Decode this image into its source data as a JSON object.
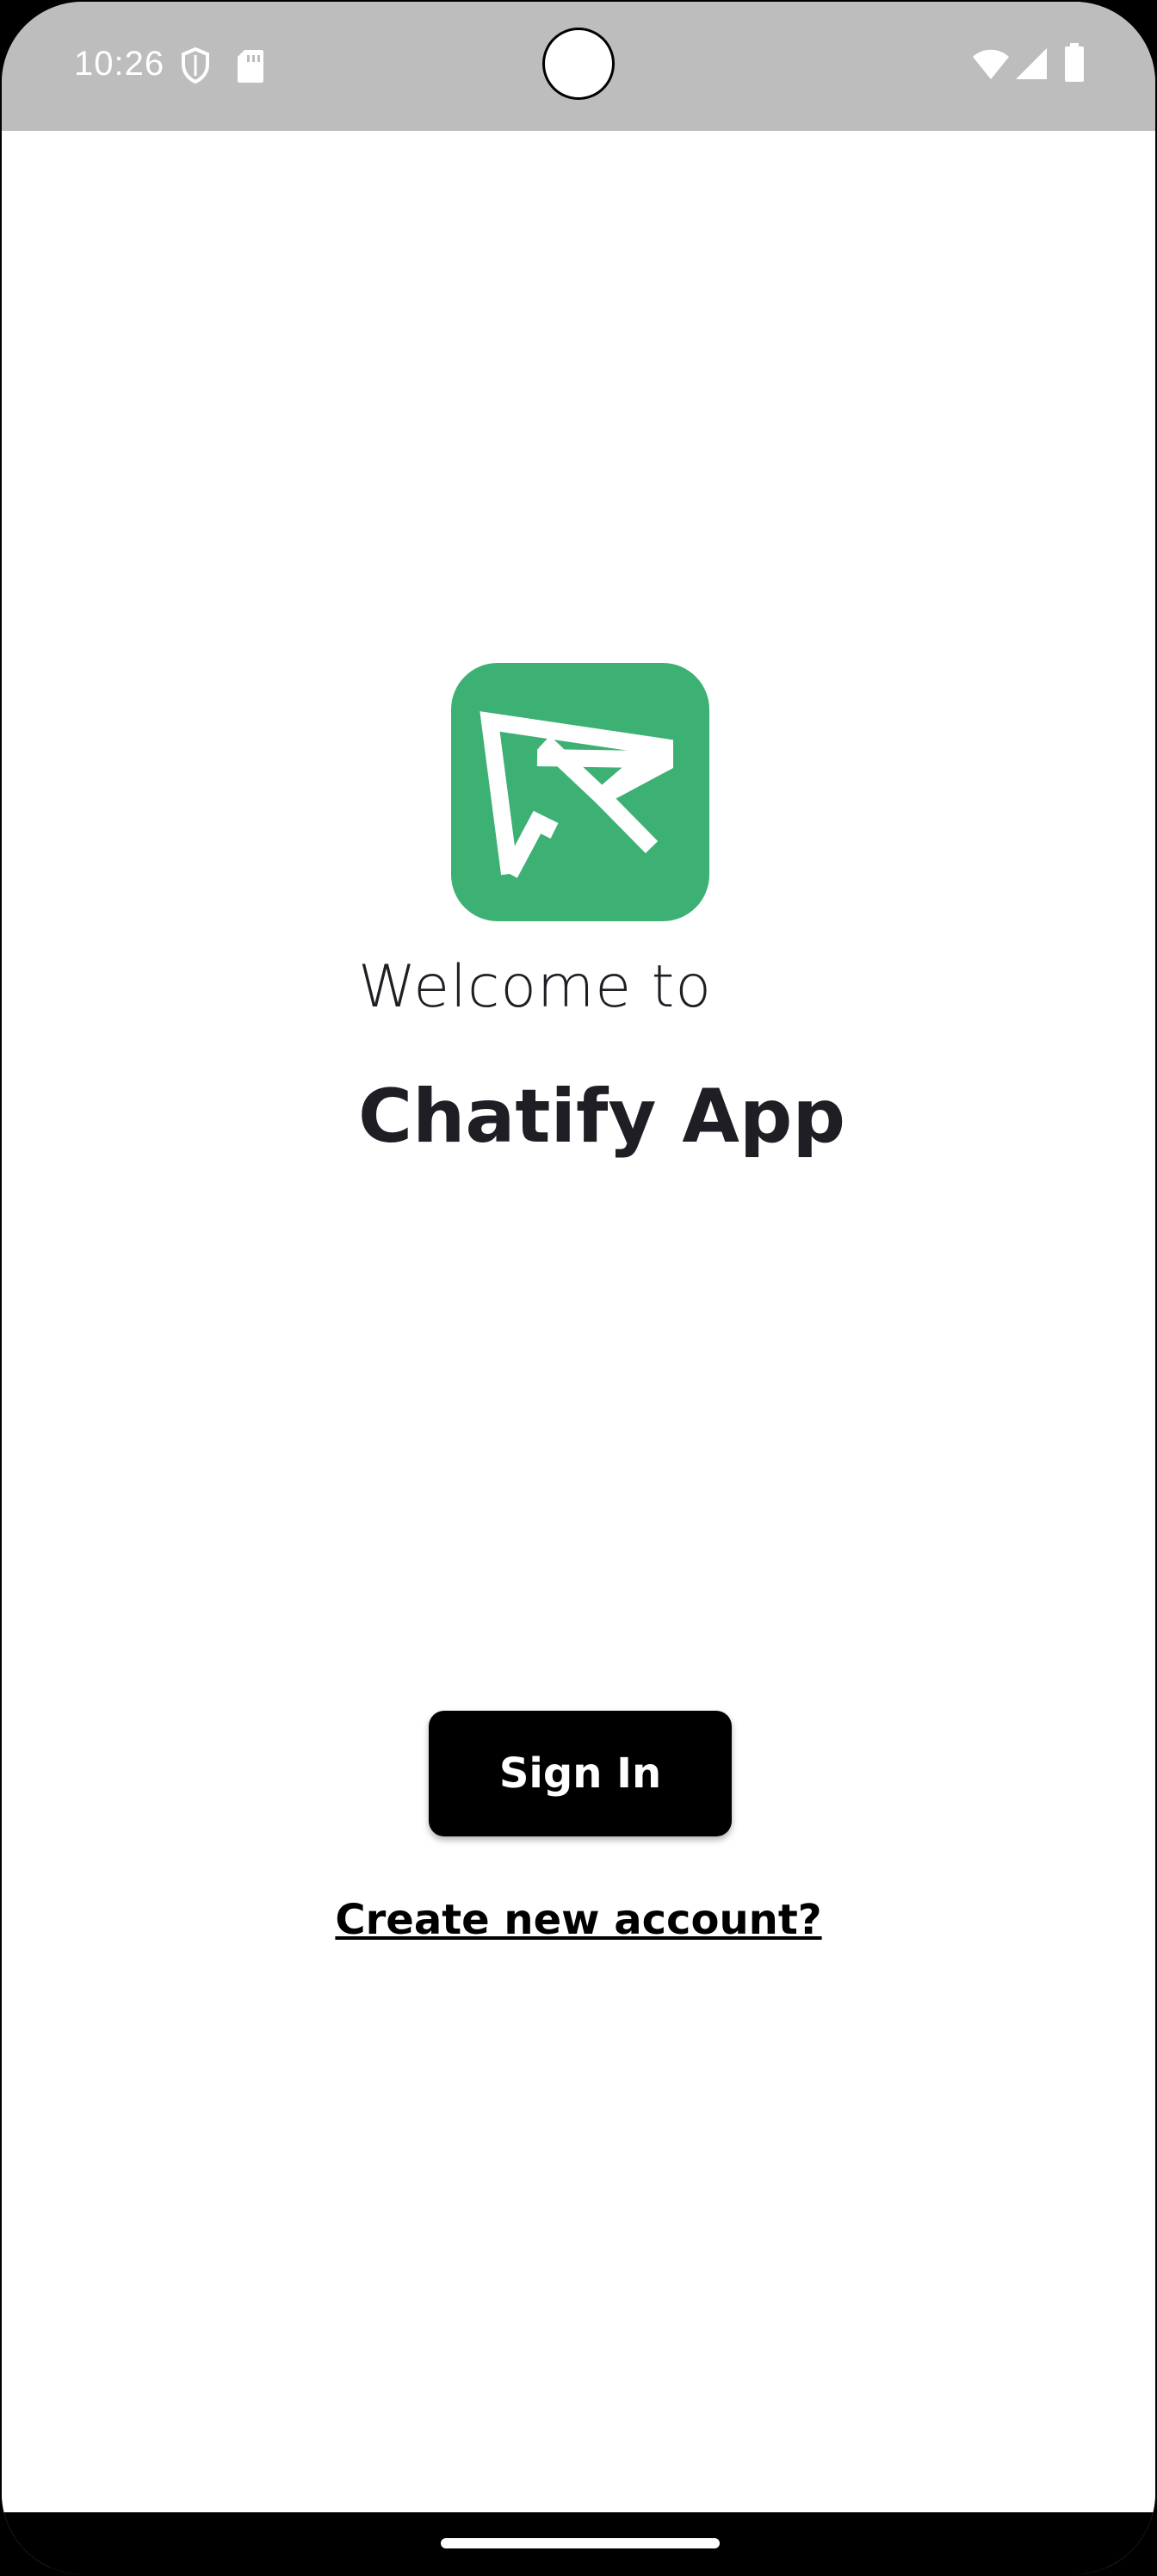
{
  "status_bar": {
    "time": "10:26",
    "left_icons": [
      "shield-icon",
      "sd-card-icon"
    ],
    "right_icons": [
      "wifi-icon",
      "cellular-signal-icon",
      "battery-icon"
    ],
    "background_color": "#bdbdbd"
  },
  "logo": {
    "icon": "send-arrow-logo-icon",
    "background_color": "#3db174"
  },
  "welcome": {
    "line1": "Welcome to",
    "line2": "Chatify App"
  },
  "actions": {
    "sign_in_label": "Sign In",
    "create_account_label": "Create new account?"
  }
}
